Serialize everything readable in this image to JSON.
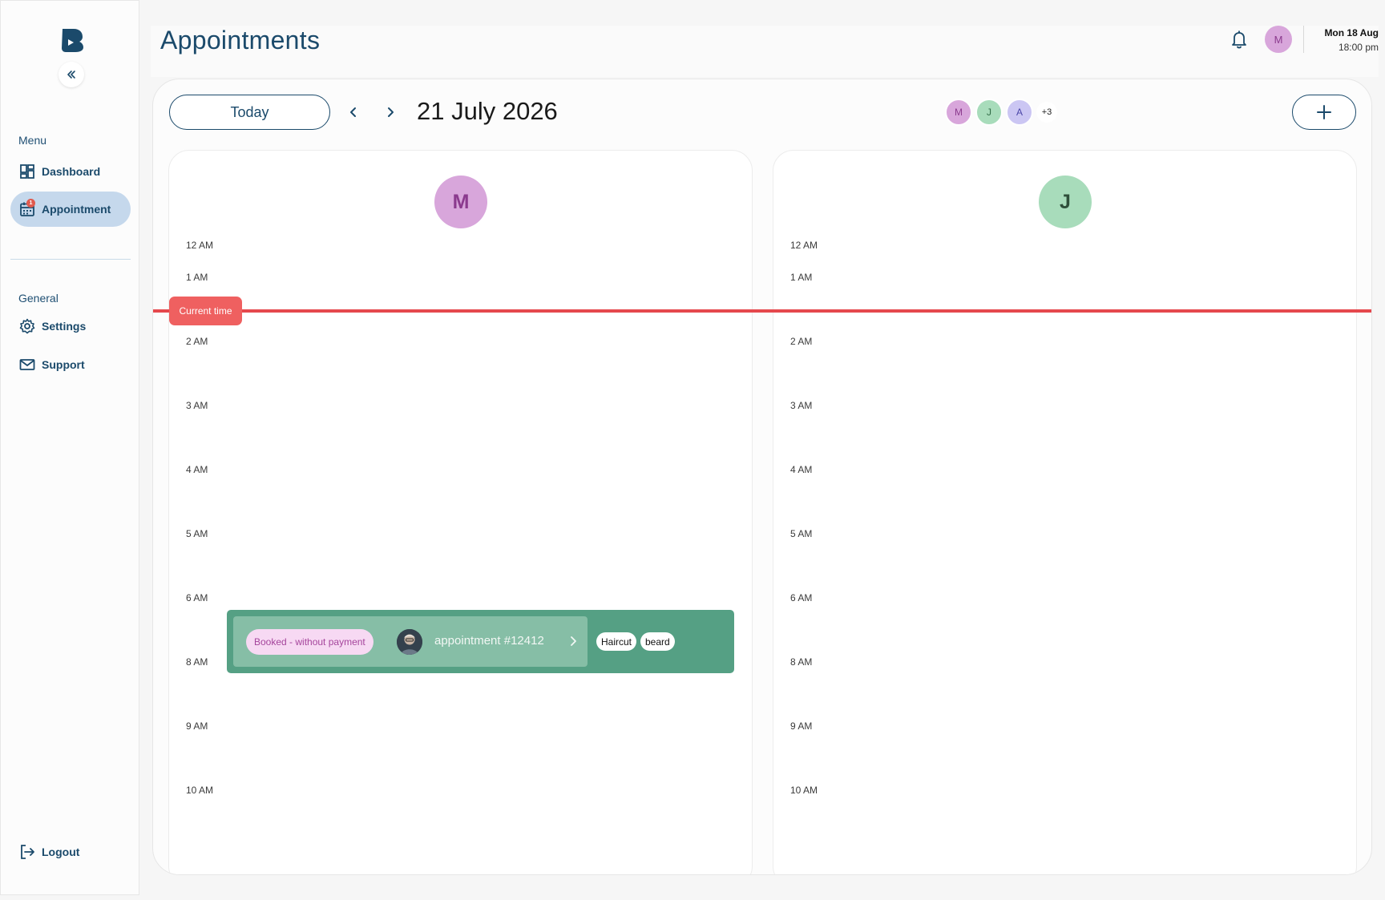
{
  "sidebar": {
    "menu_label": "Menu",
    "general_label": "General",
    "items": [
      {
        "label": "Dashboard"
      },
      {
        "label": "Appointment",
        "badge": "1"
      },
      {
        "label": "Settings"
      },
      {
        "label": "Support"
      },
      {
        "label": "Logout"
      }
    ]
  },
  "header": {
    "title": "Appointments",
    "user_initial": "M",
    "date": "Mon 18 Aug",
    "time": "18:00 pm"
  },
  "calendar": {
    "today_label": "Today",
    "date": "21 July 2026",
    "staff": [
      {
        "initial": "M",
        "bg": "#d8a6db",
        "fg": "#8b3a8e"
      },
      {
        "initial": "J",
        "bg": "#a8dcbb",
        "fg": "#2f6a45"
      },
      {
        "initial": "A",
        "bg": "#cbc6f3",
        "fg": "#4a45a8"
      }
    ],
    "staff_more": "+3",
    "current_time_label": "Current time",
    "hours": [
      "12 AM",
      "1 AM",
      "2 AM",
      "3 AM",
      "4 AM",
      "5 AM",
      "6 AM",
      "8 AM",
      "9 AM",
      "10 AM"
    ],
    "columns": [
      {
        "initial": "M",
        "bg": "#d8a6db",
        "fg": "#8b3a8e"
      },
      {
        "initial": "J",
        "bg": "#a8dcbb",
        "fg": "#2f4f3a"
      }
    ],
    "appointment": {
      "status": "Booked - without payment",
      "name": "appointment #12412",
      "services": [
        "Haircut",
        "beard"
      ]
    }
  },
  "colors": {
    "brand": "#1b4a6b",
    "current_time": "#e5484d",
    "appointment": "#55a084"
  }
}
